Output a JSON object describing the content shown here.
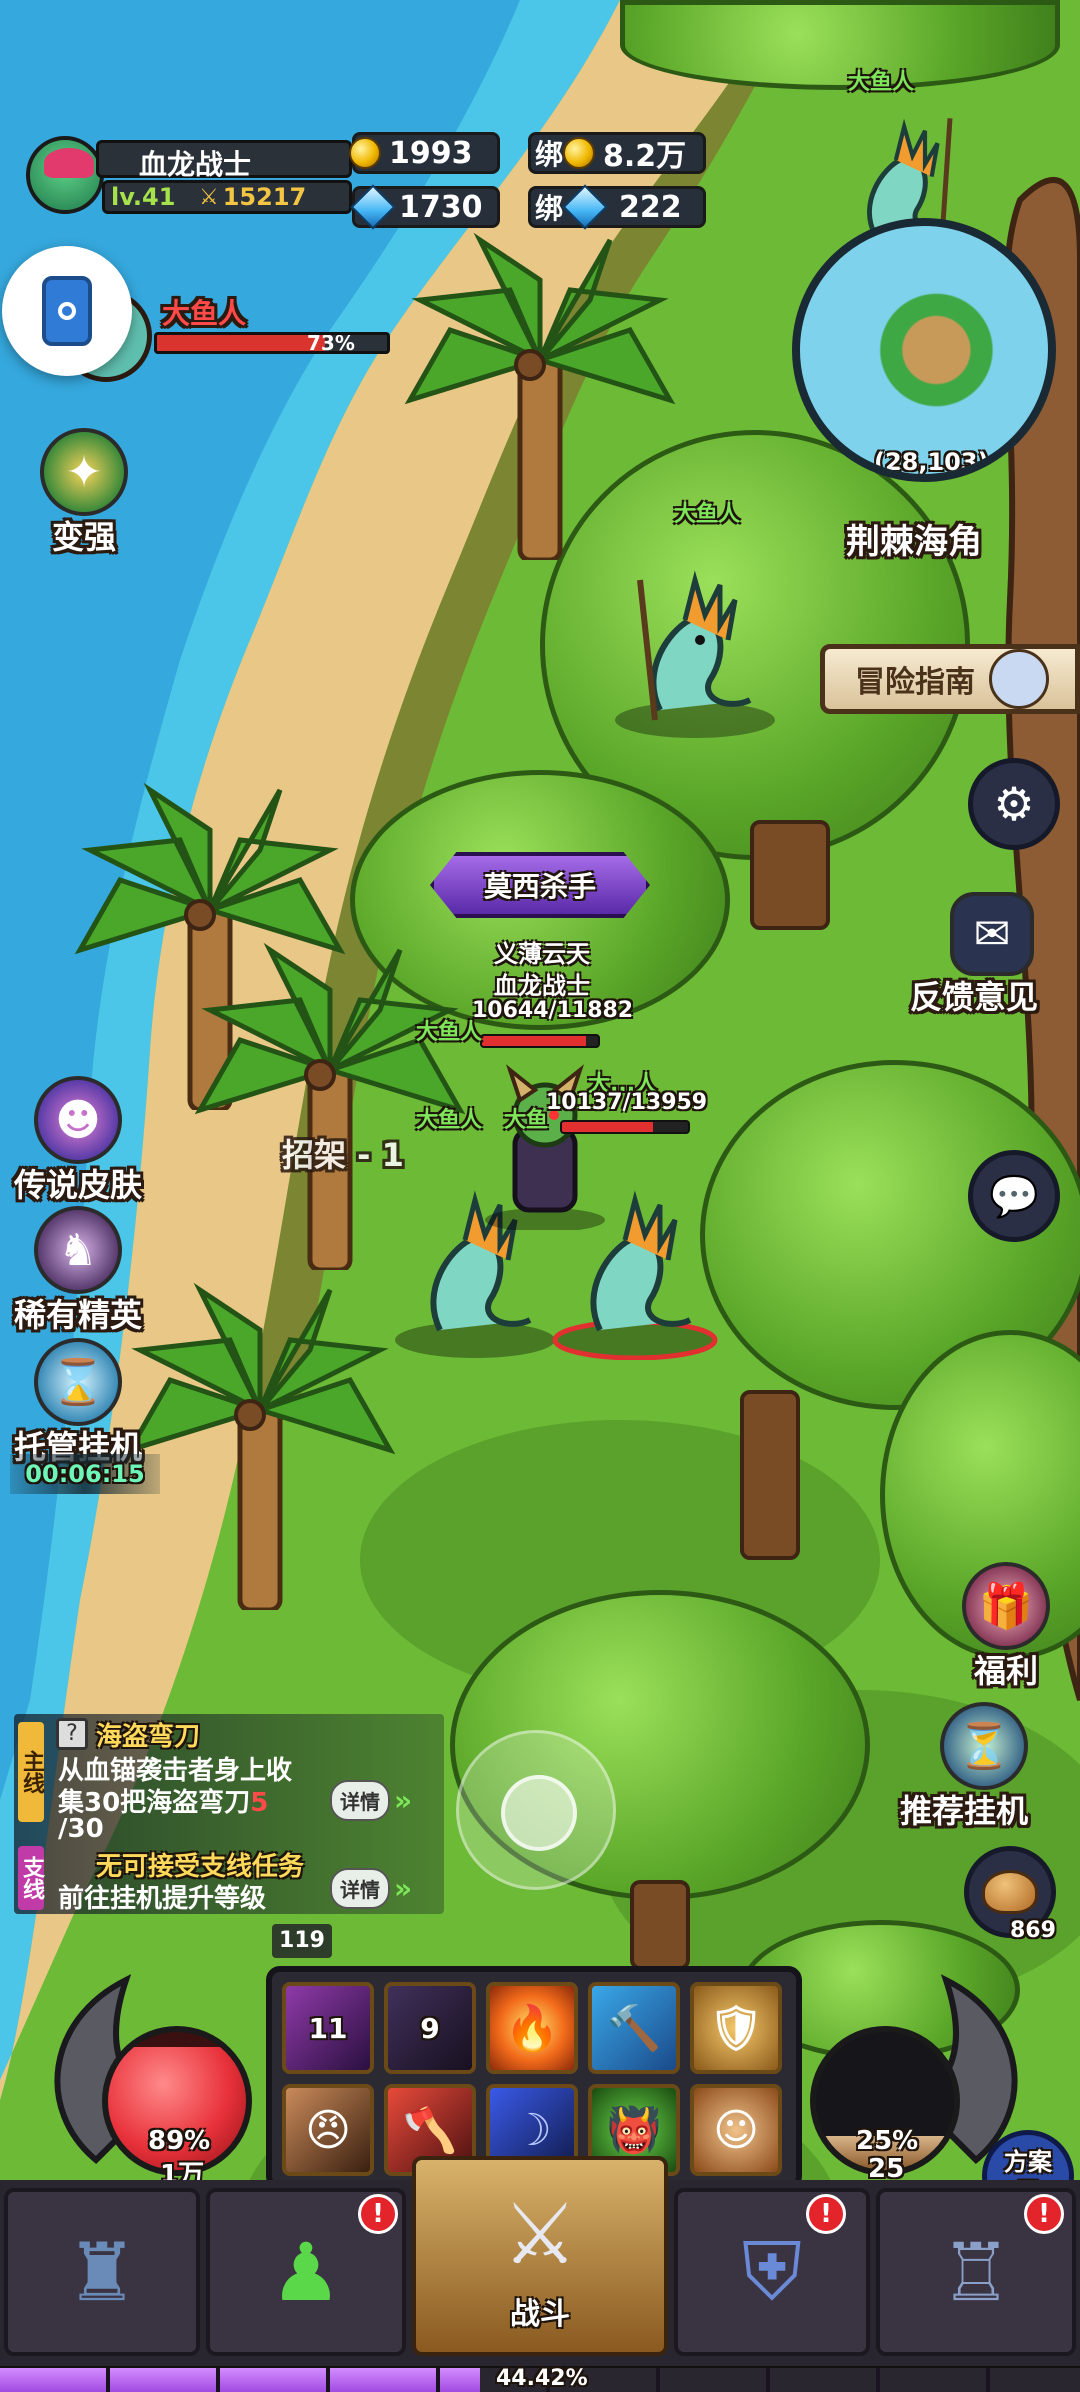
{
  "player": {
    "name": "血龙战士",
    "level": "lv.41",
    "power": "15217"
  },
  "currency": {
    "gold": "1993",
    "bound_label": "绑",
    "bound_gold": "8.2万",
    "diamond": "1730",
    "bound_diamond": "222"
  },
  "target": {
    "name": "大鱼人",
    "hp_percent": "73%",
    "hp_fraction": 0.73
  },
  "minimap": {
    "coords": "(28,103)",
    "location": "荆棘海角"
  },
  "left_menu": {
    "strengthen": "变强",
    "legend_skin": "传说皮肤",
    "rare_elite": "稀有精英",
    "auto_idle": "托管挂机",
    "idle_timer": "00:06:15"
  },
  "right_menu": {
    "guide": "冒险指南",
    "feedback": "反馈意见",
    "welfare": "福利",
    "recommend_idle": "推荐挂机",
    "bread_count": "869"
  },
  "battle": {
    "boss_title": "莫西杀手",
    "guild_name": "义薄云天",
    "player_name": "血龙战士",
    "player_hp": "10644/11882",
    "player_hp_fraction": 0.896,
    "enemy_label_1": "大鱼人",
    "enemy_hp": "10137/13959",
    "enemy_hp_fraction": 0.726,
    "enemy_label_2": "大鱼人",
    "enemy_label_3": "大鱼",
    "enemy_label_4": "大...人",
    "parry_text": "招架 - 1",
    "mob_label_top": "大鱼人",
    "mob_label_mid": "大鱼人"
  },
  "quests": {
    "main_tag": "主线",
    "main_title": "海盗弯刀",
    "main_desc_1": "从血锚袭击者身上收",
    "main_desc_2": "集30把海盗弯刀",
    "main_progress_current": "5",
    "main_progress_total": "/30",
    "details": "详情",
    "side_tag": "支线",
    "side_title": "无可接受支线任务",
    "side_desc": "前往挂机提升等级"
  },
  "hud": {
    "skill_count": "119",
    "skill_1_count": "11",
    "skill_2_count": "9",
    "hp_percent": "89%",
    "hp_value": "1万",
    "hp_fraction": 0.89,
    "mp_percent": "25%",
    "mp_value": "25",
    "mp_fraction": 0.25,
    "scheme": "方案二"
  },
  "nav": {
    "battle": "战斗"
  },
  "exp": {
    "percent": "44.42%",
    "fraction": 0.4442
  },
  "colors": {
    "hp": "#e8313a",
    "exp": "#b25ee8",
    "hp_green": "#4bd36b",
    "enemy_red": "#e23030"
  }
}
